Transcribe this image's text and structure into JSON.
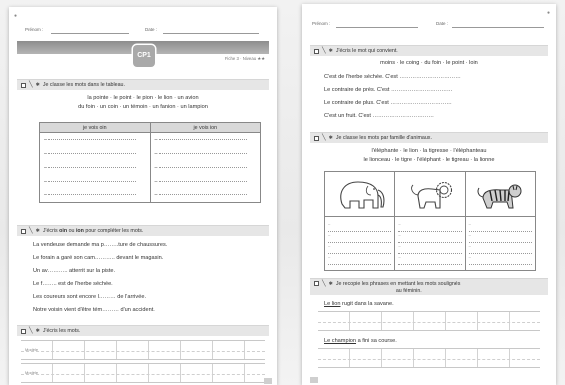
{
  "left_page": {
    "header": {
      "name_label": "Prénom :",
      "date_label": "Date :"
    },
    "lesson_badge": "CP1",
    "band_ref": "Fiche 3 · Niveau ★★",
    "exercise1": {
      "instruction": "Je classe les mots dans le tableau.",
      "word_list_line1": "la pointe · le point · le pion · le lion · un avion",
      "word_list_line2": "du foin · un coin · un témoin · un fanion · un lampion",
      "columns": [
        "je vois oin",
        "je vois ion"
      ],
      "row_marker": "–"
    },
    "exercise2": {
      "instruction_prefix": "J'écris ",
      "instruction_bold1": "oin",
      "instruction_mid": " ou ",
      "instruction_bold2": "ion",
      "instruction_suffix": " pour compléter les mots.",
      "sentences": [
        "La vendeuse demande ma p……..ture de chaussures.",
        "Le forain a garé son cam……….. devant le magasin.",
        "Un av……….. atterrit sur la piste.",
        "Le f…….. est de l'herbe séchée.",
        "Les coureurs sont encore l……… de l'arrivée.",
        "Notre voisin vient d'être tém……… d'un accident."
      ]
    },
    "exercise3": {
      "instruction": "J'écris les mots.",
      "line_labels": [
        "Modèle",
        "Modèle"
      ]
    }
  },
  "right_page": {
    "header": {
      "name_label": "Prénom :",
      "date_label": "Date :"
    },
    "exercise1": {
      "instruction": "J'écris le mot qui convient.",
      "word_list": "moins · le coing · du foin · le point · loin",
      "sentences": [
        "C'est de l'herbe séchée. C'est ……………………………",
        "Le contraire de près. C'est ……………………………",
        "Le contraire de plus. C'est ……………………………",
        "C'est un fruit. C'est ……………………………"
      ]
    },
    "exercise2": {
      "instruction": "Je classe les mots par famille d'animaux.",
      "word_list_line1": "l'éléphante · le lion · la tigresse · l'éléphanteau",
      "word_list_line2": "le lionceau · le tigre · l'éléphant · le tigreau · la lionne",
      "animals": [
        "elephant-icon",
        "lion-icon",
        "tiger-icon"
      ],
      "row_marker": "–"
    },
    "exercise3": {
      "instruction_line1": "Je recopie les phrases en mettant les mots soulignés",
      "instruction_line2": "au féminin.",
      "sentence1_underlined": "Le lion",
      "sentence1_rest": " rugit dans la savane.",
      "sentence2_underlined": "Le champion",
      "sentence2_rest": " a fini sa course."
    }
  }
}
